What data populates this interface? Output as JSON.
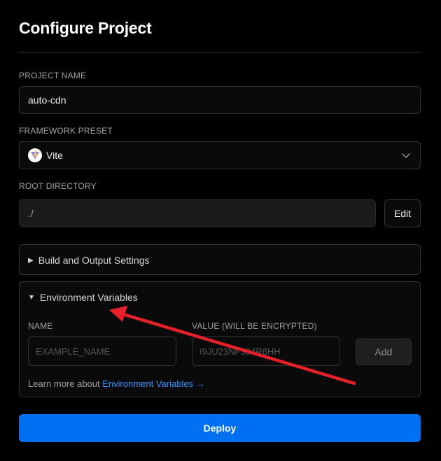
{
  "header": {
    "title": "Configure Project"
  },
  "project_name": {
    "label": "PROJECT NAME",
    "value": "auto-cdn"
  },
  "framework": {
    "label": "FRAMEWORK PRESET",
    "value": "Vite",
    "icon": "vite-logo-icon"
  },
  "root_directory": {
    "label": "ROOT DIRECTORY",
    "value": "./",
    "edit_label": "Edit"
  },
  "build_settings": {
    "label": "Build and Output Settings",
    "expanded": false
  },
  "env": {
    "label": "Environment Variables",
    "expanded": true,
    "name_label": "NAME",
    "value_label": "VALUE (WILL BE ENCRYPTED)",
    "name_placeholder": "EXAMPLE_NAME",
    "value_placeholder": "I9JU23NF394R6HH",
    "add_label": "Add",
    "learn_prefix": "Learn more about ",
    "learn_link": "Environment Variables →"
  },
  "deploy": {
    "label": "Deploy"
  },
  "colors": {
    "accent": "#0070f3",
    "link": "#3291ff",
    "annotation_arrow": "#e8202a"
  }
}
